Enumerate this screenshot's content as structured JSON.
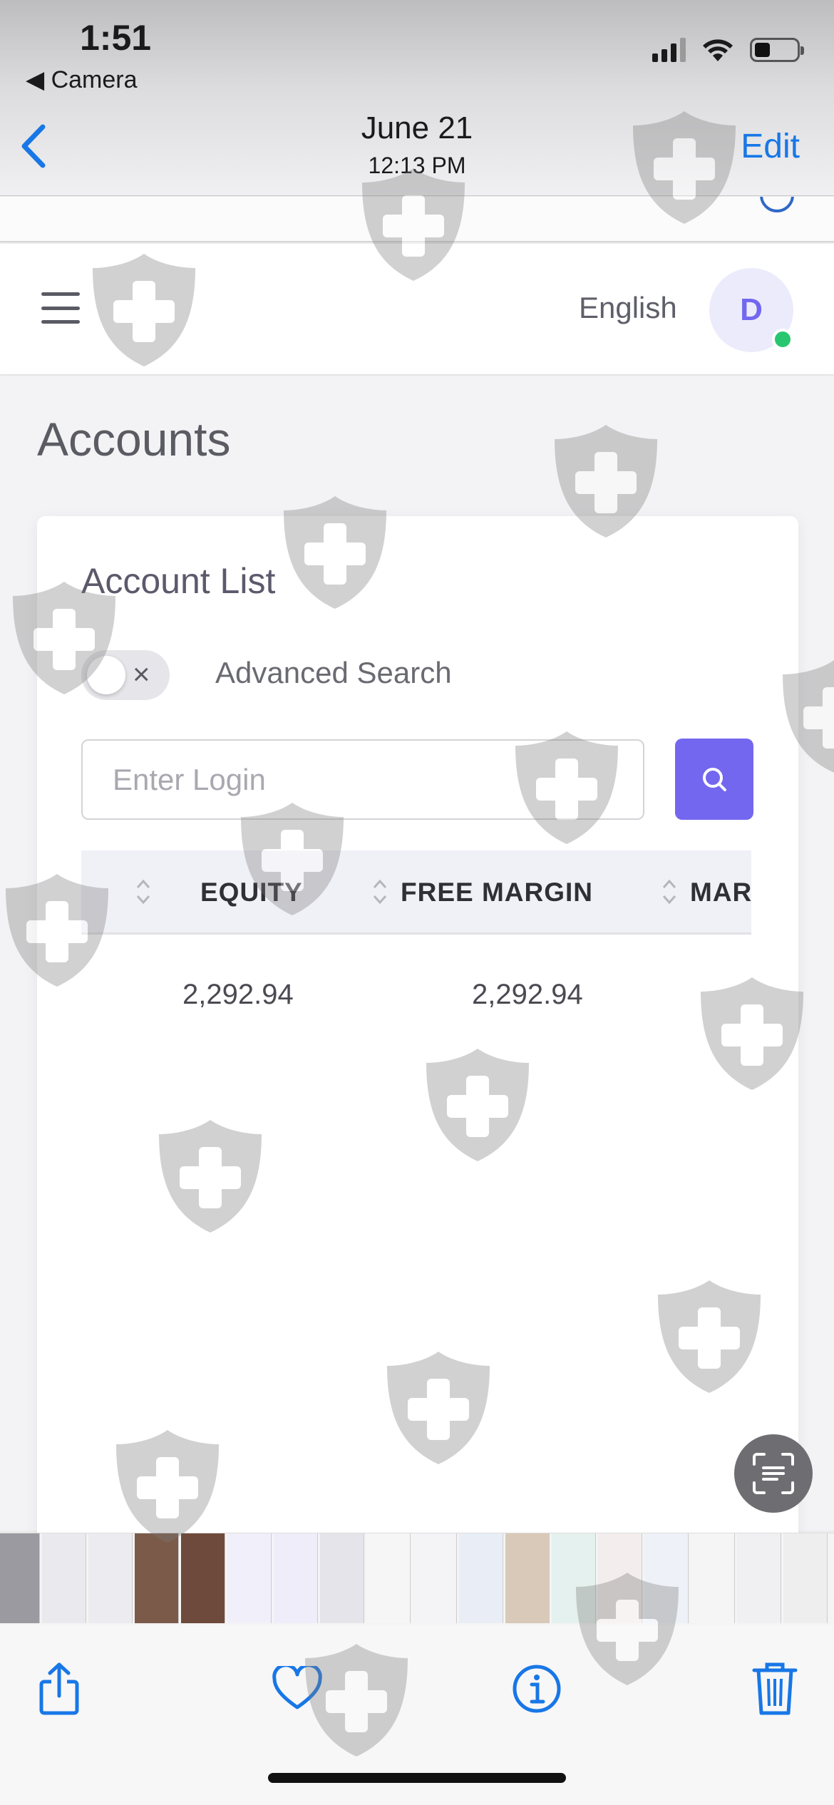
{
  "status_bar": {
    "time": "1:51",
    "back_app": "◀ Camera"
  },
  "photos_header": {
    "date": "June 21",
    "time": "12:13 PM",
    "edit_label": "Edit"
  },
  "site_header": {
    "language": "English",
    "avatar_initial": "D",
    "online_color": "#28c76f"
  },
  "page": {
    "title": "Accounts"
  },
  "account_list": {
    "title": "Account List",
    "advanced_search_label": "Advanced Search",
    "advanced_search_toggle_mark": "×",
    "login_input": {
      "placeholder": "Enter Login",
      "value": ""
    },
    "table": {
      "columns": [
        "EQUITY",
        "FREE MARGIN",
        "MAR"
      ],
      "rows": [
        {
          "equity": "2,292.94",
          "free_margin": "2,292.94"
        }
      ]
    }
  },
  "colors": {
    "accent": "#7367f0",
    "ios_blue": "#1877e6"
  },
  "toolbar": {
    "icons": [
      "share-icon",
      "heart-icon",
      "info-icon",
      "trash-icon"
    ]
  }
}
